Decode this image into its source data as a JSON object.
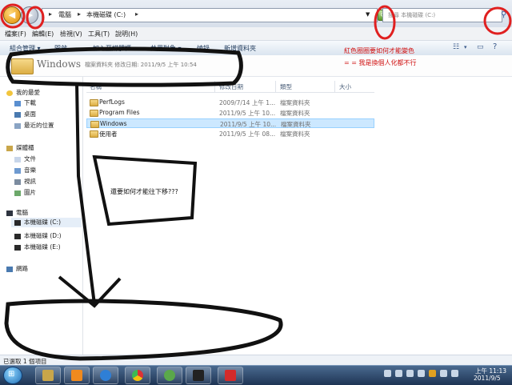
{
  "address_bar": {
    "crumbs": [
      "電腦",
      "本機磁碟 (C:)"
    ],
    "search_placeholder": "搜尋 本機磁碟 (C:)"
  },
  "menu": [
    "檔案(F)",
    "編輯(E)",
    "檢視(V)",
    "工具(T)",
    "說明(H)"
  ],
  "toolbar": {
    "organize": "組合管理 ▾",
    "open": "開啟",
    "include": "加入至媒體櫃 ▾",
    "share": "共用對象 ▾",
    "burn": "燒錄",
    "new_folder": "新增資料夾"
  },
  "header": {
    "title": "Windows",
    "detail": "檔案資料夾  修改日期: 2011/9/5 上午 10:54"
  },
  "annotations": {
    "note1": "紅色圈圈要如何才能變色",
    "note2": "= = 我是換個人化都不行",
    "note3": "還要如何才能往下移???"
  },
  "sidebar": {
    "favorites_label": "我的最愛",
    "favorites": [
      "下載",
      "桌面",
      "最近的位置"
    ],
    "libraries_label": "媒體櫃",
    "libraries": [
      "文件",
      "音樂",
      "視訊",
      "圖片"
    ],
    "computer_label": "電腦",
    "drives": [
      "本機磁碟 (C:)",
      "本機磁碟 (D:)",
      "本機磁碟 (E:)"
    ],
    "network_label": "網路"
  },
  "columns": {
    "name": "名稱",
    "date": "修改日期",
    "type": "類型",
    "size": "大小"
  },
  "files": [
    {
      "name": "PerfLogs",
      "date": "2009/7/14 上午 1...",
      "type": "檔案資料夾"
    },
    {
      "name": "Program Files",
      "date": "2011/9/5 上午 10...",
      "type": "檔案資料夾"
    },
    {
      "name": "Windows",
      "date": "2011/9/5 上午 10...",
      "type": "檔案資料夾"
    },
    {
      "name": "使用者",
      "date": "2011/9/5 上午 08...",
      "type": "檔案資料夾"
    }
  ],
  "selected_file_index": 2,
  "status": {
    "text": "已選取 1 個項目"
  },
  "taskbar": {
    "time": "上午 11:13",
    "date": "2011/9/5",
    "apps": [
      "explorer-icon",
      "media-player-icon",
      "ie-icon",
      "chrome-icon",
      "messenger-icon",
      "foobar-icon",
      "media-icon"
    ]
  },
  "colors": {
    "annotation_red": "#d01010",
    "selection": "#cce8ff",
    "folder": "#dcae44"
  }
}
